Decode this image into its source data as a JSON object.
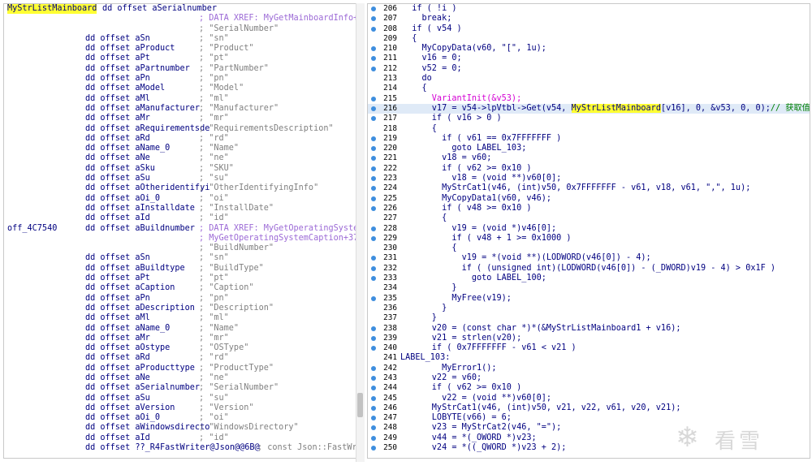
{
  "left": {
    "lines": [
      {
        "label": "MyStrListMainboard",
        "label_hl": true,
        "code": "dd offset aSerialnumber",
        "code_inline": true,
        "comment": ""
      },
      {
        "label": "",
        "code": "",
        "comment": "; DATA XREF: MyGetMainboardInfo+3",
        "xref": true
      },
      {
        "label": "",
        "code": "",
        "comment": "; \"SerialNumber\""
      },
      {
        "label": "",
        "code": "dd offset aSn",
        "comment": "; \"sn\""
      },
      {
        "label": "",
        "code": "dd offset aProduct",
        "comment": "; \"Product\""
      },
      {
        "label": "",
        "code": "dd offset aPt",
        "comment": "; \"pt\""
      },
      {
        "label": "",
        "code": "dd offset aPartnumber",
        "comment": "; \"PartNumber\""
      },
      {
        "label": "",
        "code": "dd offset aPn",
        "comment": "; \"pn\""
      },
      {
        "label": "",
        "code": "dd offset aModel",
        "comment": "; \"Model\""
      },
      {
        "label": "",
        "code": "dd offset aMl",
        "comment": "; \"ml\""
      },
      {
        "label": "",
        "code": "dd offset aManufacturer",
        "comment": "; \"Manufacturer\""
      },
      {
        "label": "",
        "code": "dd offset aMr",
        "comment": "; \"mr\""
      },
      {
        "label": "",
        "code": "dd offset aRequirementsde",
        "comment": "; \"RequirementsDescription\""
      },
      {
        "label": "",
        "code": "dd offset aRd",
        "comment": "; \"rd\""
      },
      {
        "label": "",
        "code": "dd offset aName_0",
        "comment": "; \"Name\""
      },
      {
        "label": "",
        "code": "dd offset aNe",
        "comment": "; \"ne\""
      },
      {
        "label": "",
        "code": "dd offset aSku",
        "comment": "; \"SKU\""
      },
      {
        "label": "",
        "code": "dd offset aSu",
        "comment": "; \"su\""
      },
      {
        "label": "",
        "code": "dd offset aOtheridentifyi",
        "comment": "; \"OtherIdentifyingInfo\""
      },
      {
        "label": "",
        "code": "dd offset aOi_0",
        "comment": "; \"oi\""
      },
      {
        "label": "",
        "code": "dd offset aInstalldate",
        "comment": "; \"InstallDate\""
      },
      {
        "label": "",
        "code": "dd offset aId",
        "comment": "; \"id\""
      },
      {
        "label": "off_4C7540",
        "code": "dd offset aBuildnumber",
        "comment": "; DATA XREF: MyGetOperatingSystem",
        "xref": true
      },
      {
        "label": "",
        "code": "",
        "comment": "; MyGetOperatingSystemCaption+372",
        "xref": true
      },
      {
        "label": "",
        "code": "",
        "comment": "; \"BuildNumber\""
      },
      {
        "label": "",
        "code": "dd offset aSn",
        "comment": "; \"sn\""
      },
      {
        "label": "",
        "code": "dd offset aBuildtype",
        "comment": "; \"BuildType\""
      },
      {
        "label": "",
        "code": "dd offset aPt",
        "comment": "; \"pt\""
      },
      {
        "label": "",
        "code": "dd offset aCaption",
        "comment": "; \"Caption\""
      },
      {
        "label": "",
        "code": "dd offset aPn",
        "comment": "; \"pn\""
      },
      {
        "label": "",
        "code": "dd offset aDescription",
        "comment": "; \"Description\""
      },
      {
        "label": "",
        "code": "dd offset aMl",
        "comment": "; \"ml\""
      },
      {
        "label": "",
        "code": "dd offset aName_0",
        "comment": "; \"Name\""
      },
      {
        "label": "",
        "code": "dd offset aMr",
        "comment": "; \"mr\""
      },
      {
        "label": "",
        "code": "dd offset aOstype",
        "comment": "; \"OSType\""
      },
      {
        "label": "",
        "code": "dd offset aRd",
        "comment": "; \"rd\""
      },
      {
        "label": "",
        "code": "dd offset aProducttype",
        "comment": "; \"ProductType\""
      },
      {
        "label": "",
        "code": "dd offset aNe",
        "comment": "; \"ne\""
      },
      {
        "label": "",
        "code": "dd offset aSerialnumber",
        "comment": "; \"SerialNumber\""
      },
      {
        "label": "",
        "code": "dd offset aSu",
        "comment": "; \"su\""
      },
      {
        "label": "",
        "code": "dd offset aVersion",
        "comment": "; \"Version\""
      },
      {
        "label": "",
        "code": "dd offset aOi_0",
        "comment": "; \"oi\""
      },
      {
        "label": "",
        "code": "dd offset aWindowsdirecto",
        "comment": "; \"WindowsDirectory\""
      },
      {
        "label": "",
        "code": "dd offset aId",
        "comment": "; \"id\""
      },
      {
        "label": "",
        "code": "dd offset ??_R4FastWriter@Json@@6B@",
        "comment": "; const Json::FastWri",
        "trail": true
      }
    ]
  },
  "right": {
    "lines": [
      {
        "n": "206",
        "dot": true,
        "text": "  if ( !i )"
      },
      {
        "n": "207",
        "dot": true,
        "text": "    break;"
      },
      {
        "n": "208",
        "dot": true,
        "text": "  if ( v54 )"
      },
      {
        "n": "209",
        "dot": false,
        "text": "  {"
      },
      {
        "n": "210",
        "dot": true,
        "text": "    MyCopyData(v60, \"[\", 1u);"
      },
      {
        "n": "211",
        "dot": true,
        "text": "    v16 = 0;"
      },
      {
        "n": "212",
        "dot": true,
        "text": "    v52 = 0;"
      },
      {
        "n": "213",
        "dot": false,
        "text": "    do"
      },
      {
        "n": "214",
        "dot": false,
        "text": "    {"
      },
      {
        "n": "215",
        "dot": true,
        "text": "      VariantInit(&v53);"
      },
      {
        "n": "216",
        "dot": true,
        "sel": true,
        "pre": "      v17 = v54->lpVtbl->Get(v54, ",
        "hl": "MyStrListMainboard",
        "post": "[v16], 0, &v53, 0, 0);",
        "cmt": "// 获取值"
      },
      {
        "n": "217",
        "dot": true,
        "text": "      if ( v16 > 0 )"
      },
      {
        "n": "218",
        "dot": false,
        "text": "      {"
      },
      {
        "n": "219",
        "dot": true,
        "text": "        if ( v61 == 0x7FFFFFFF )"
      },
      {
        "n": "220",
        "dot": true,
        "text": "          goto LABEL_103;"
      },
      {
        "n": "221",
        "dot": true,
        "text": "        v18 = v60;"
      },
      {
        "n": "222",
        "dot": true,
        "text": "        if ( v62 >= 0x10 )"
      },
      {
        "n": "223",
        "dot": true,
        "text": "          v18 = (void **)v60[0];"
      },
      {
        "n": "224",
        "dot": true,
        "text": "        MyStrCat1(v46, (int)v50, 0x7FFFFFFF - v61, v18, v61, \",\", 1u);"
      },
      {
        "n": "225",
        "dot": true,
        "text": "        MyCopyData1(v60, v46);"
      },
      {
        "n": "226",
        "dot": true,
        "text": "        if ( v48 >= 0x10 )"
      },
      {
        "n": "227",
        "dot": false,
        "text": "        {"
      },
      {
        "n": "228",
        "dot": true,
        "text": "          v19 = (void *)v46[0];"
      },
      {
        "n": "229",
        "dot": true,
        "text": "          if ( v48 + 1 >= 0x1000 )"
      },
      {
        "n": "230",
        "dot": false,
        "text": "          {"
      },
      {
        "n": "231",
        "dot": true,
        "text": "            v19 = *(void **)(LODWORD(v46[0]) - 4);"
      },
      {
        "n": "232",
        "dot": true,
        "text": "            if ( (unsigned int)(LODWORD(v46[0]) - (_DWORD)v19 - 4) > 0x1F )"
      },
      {
        "n": "233",
        "dot": true,
        "text": "              goto LABEL_100;"
      },
      {
        "n": "234",
        "dot": false,
        "text": "          }"
      },
      {
        "n": "235",
        "dot": true,
        "text": "          MyFree(v19);"
      },
      {
        "n": "236",
        "dot": false,
        "text": "        }"
      },
      {
        "n": "237",
        "dot": false,
        "text": "      }"
      },
      {
        "n": "238",
        "dot": true,
        "text": "      v20 = (const char *)*(&MyStrListMainboard1 + v16);"
      },
      {
        "n": "239",
        "dot": true,
        "text": "      v21 = strlen(v20);"
      },
      {
        "n": "240",
        "dot": true,
        "text": "      if ( 0x7FFFFFFF - v61 < v21 )"
      },
      {
        "n": "241",
        "dot": false,
        "label": true,
        "text": "LABEL_103:"
      },
      {
        "n": "242",
        "dot": true,
        "text": "        MyError1();"
      },
      {
        "n": "243",
        "dot": true,
        "text": "      v22 = v60;"
      },
      {
        "n": "244",
        "dot": true,
        "text": "      if ( v62 >= 0x10 )"
      },
      {
        "n": "245",
        "dot": true,
        "text": "        v22 = (void **)v60[0];"
      },
      {
        "n": "246",
        "dot": true,
        "text": "      MyStrCat1(v46, (int)v50, v21, v22, v61, v20, v21);"
      },
      {
        "n": "247",
        "dot": true,
        "text": "      LOBYTE(v66) = 6;"
      },
      {
        "n": "248",
        "dot": true,
        "text": "      v23 = MyStrCat2(v46, \"=\");"
      },
      {
        "n": "249",
        "dot": true,
        "text": "      v44 = *(_OWORD *)v23;"
      },
      {
        "n": "250",
        "dot": true,
        "text": "      v24 = *((_QWORD *)v23 + 2);"
      }
    ]
  },
  "watermark": {
    "text": "看雪",
    "icon": "snowflake-icon"
  }
}
